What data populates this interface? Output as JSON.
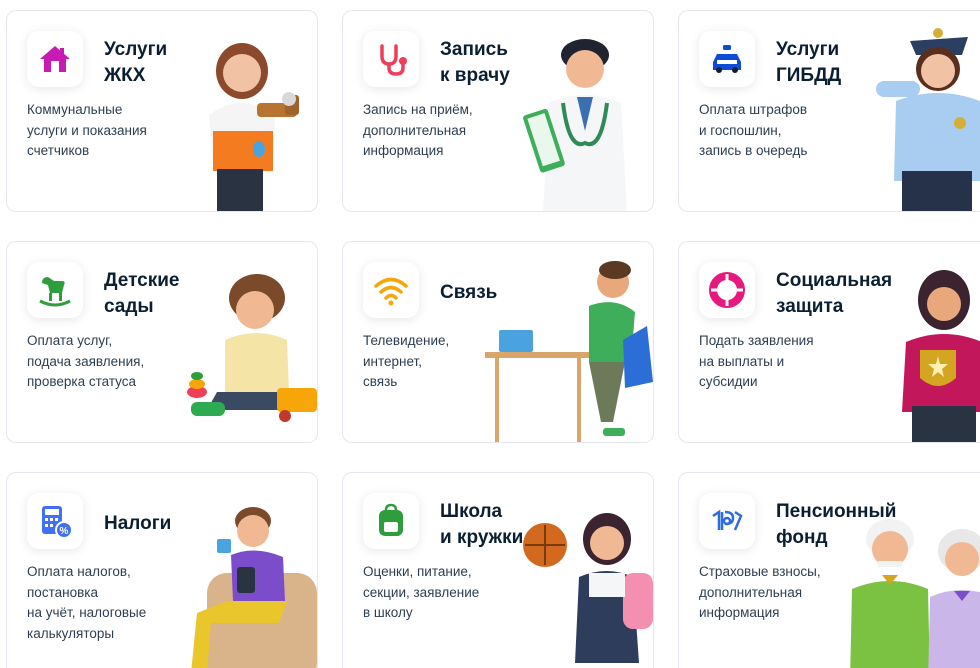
{
  "services": [
    {
      "title": "Услуги\nЖКХ",
      "description": "Коммунальные\nуслуги и показания\nсчетчиков",
      "icon": "house-icon",
      "illustration": "woman-with-faucet-illustration",
      "accent": "#c71bb3"
    },
    {
      "title": "Запись\nк врачу",
      "description": "Запись на приём,\nдополнительная\nинформация",
      "icon": "stethoscope-icon",
      "illustration": "doctor-illustration",
      "accent": "#ee3f58"
    },
    {
      "title": "Услуги\nГИБДД",
      "description": "Оплата штрафов\nи госпошлин,\nзапись в очередь",
      "icon": "police-car-icon",
      "illustration": "police-officer-illustration",
      "accent": "#0d4cd3"
    },
    {
      "title": "Детские\nсады",
      "description": "Оплата услуг,\nподача заявления,\nпроверка статуса",
      "icon": "rocking-horse-icon",
      "illustration": "child-playing-illustration",
      "accent": "#2e9e3c"
    },
    {
      "title": "Связь",
      "description": "Телевидение,\nинтернет,\nсвязь",
      "icon": "wifi-icon",
      "illustration": "man-at-desk-illustration",
      "accent": "#f6a609"
    },
    {
      "title": "Социальная\nзащита",
      "description": "Подать заявления\nна выплаты и\nсубсидии",
      "icon": "lifebuoy-icon",
      "illustration": "woman-with-shield-illustration",
      "accent": "#e6197e"
    },
    {
      "title": "Налоги",
      "description": "Оплата налогов,\nпостановка\nна учёт, налоговые\nкалькуляторы",
      "icon": "calculator-percent-icon",
      "illustration": "man-in-armchair-illustration",
      "accent": "#4070f4"
    },
    {
      "title": "Школа\nи кружки",
      "description": "Оценки, питание,\nсекции, заявление\nв школу",
      "icon": "backpack-icon",
      "illustration": "schoolgirl-with-ball-illustration",
      "accent": "#2e9e3c"
    },
    {
      "title": "Пенсионный\nфонд",
      "description": "Страховые взносы,\nдополнительная\nинформация",
      "icon": "pension-fund-logo-icon",
      "illustration": "elderly-couple-illustration",
      "accent": "#2d6cdf"
    }
  ]
}
